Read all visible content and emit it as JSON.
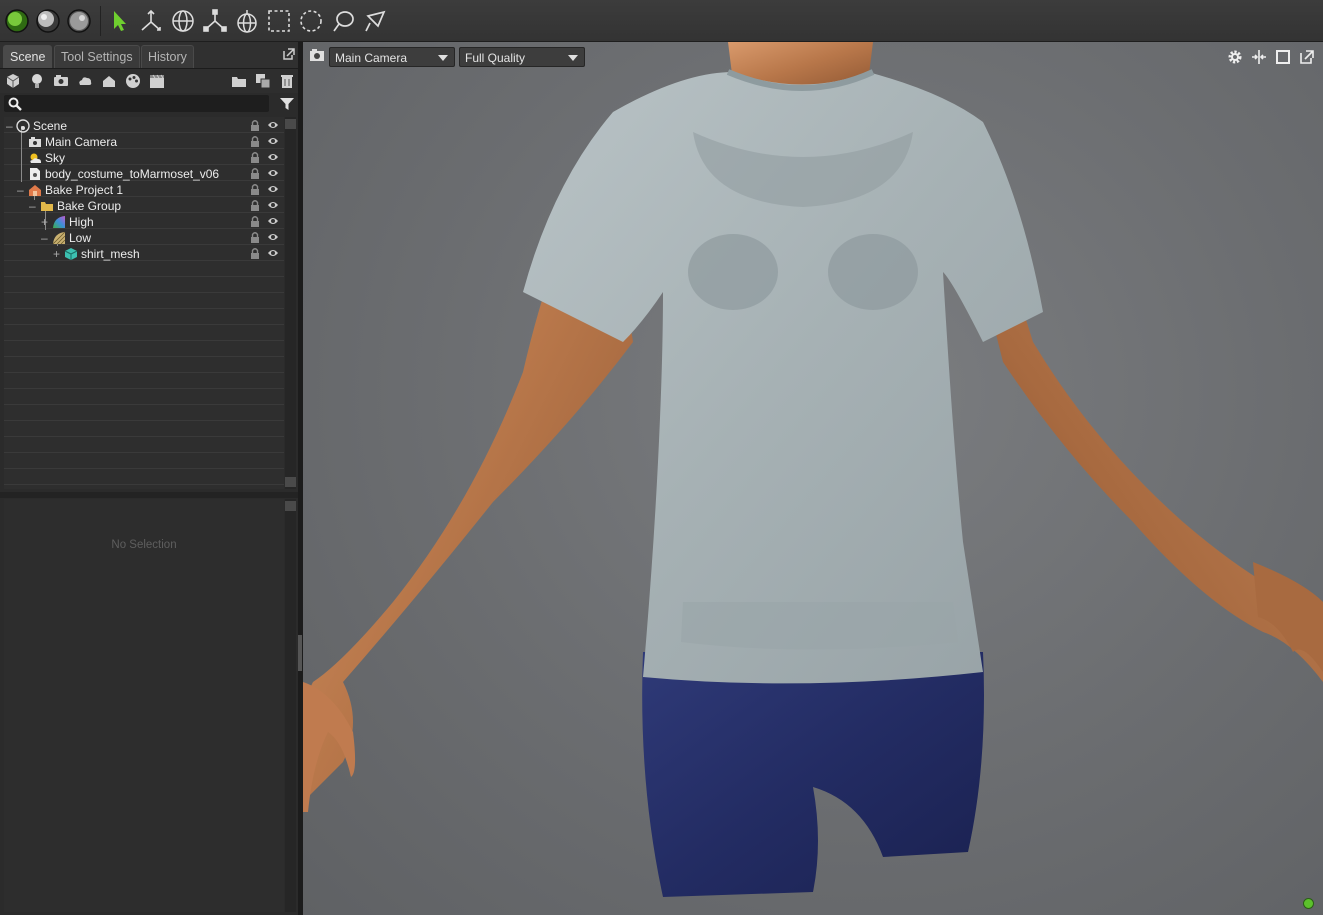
{
  "tabs": [
    "Scene",
    "Tool Settings",
    "History"
  ],
  "search": {
    "placeholder": ""
  },
  "tree": [
    {
      "label": "Scene",
      "icon": "scene-icon"
    },
    {
      "label": "Main Camera",
      "icon": "camera-icon"
    },
    {
      "label": "Sky",
      "icon": "sky-icon"
    },
    {
      "label": "body_costume_toMarmoset_v06",
      "icon": "file-icon"
    },
    {
      "label": "Bake Project 1",
      "icon": "bake-project-icon"
    },
    {
      "label": "Bake Group",
      "icon": "folder-icon"
    },
    {
      "label": "High",
      "icon": "high-mesh-icon"
    },
    {
      "label": "Low",
      "icon": "low-mesh-icon"
    },
    {
      "label": "shirt_mesh",
      "icon": "mesh-icon"
    }
  ],
  "properties": {
    "empty_text": "No Selection"
  },
  "viewport": {
    "camera": "Main Camera",
    "quality": "Full Quality"
  },
  "colors": {
    "accent_green": "#6fcf2f",
    "viewport_bg": "#6b6d70",
    "status_ok": "#5cc12c"
  }
}
